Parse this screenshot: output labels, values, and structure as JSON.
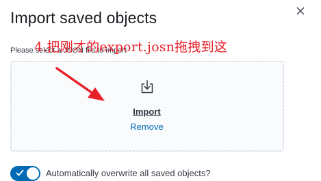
{
  "modal": {
    "title": "Import saved objects",
    "close_icon": "close-icon"
  },
  "file_picker": {
    "instruction": "Please select a JSON file to import",
    "import_label": "Import",
    "remove_label": "Remove",
    "icon": "import-icon"
  },
  "annotation": {
    "text": "4.把刚才的export.josn拖拽到这",
    "color": "#e8202a"
  },
  "overwrite_toggle": {
    "label": "Automatically overwrite all saved objects?",
    "checked": true,
    "color": "#006bb4"
  }
}
